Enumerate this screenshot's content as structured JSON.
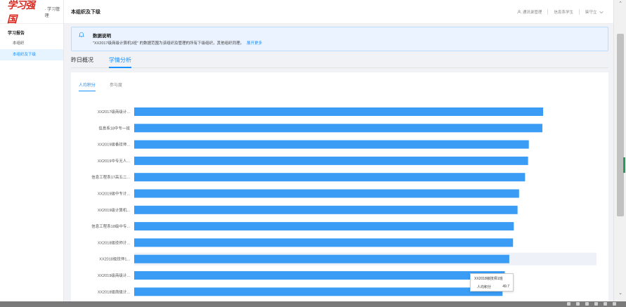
{
  "sidebar": {
    "logo_mark": "学习强国",
    "logo_text": "· 学习管理",
    "group_label": "学习报告",
    "items": [
      {
        "label": "本组织"
      },
      {
        "label": "本组织及下级"
      }
    ]
  },
  "header": {
    "page_title": "本组织及下级",
    "user_action": "通讯录管理",
    "dept": "信息系学生",
    "user_name": "柴守立"
  },
  "notice": {
    "title": "数据说明",
    "body": "\"XX2017级商级计算机3班\" 的数据范围为该组织及管理的所有下级组织，其他组织同理。",
    "link": "展开更多"
  },
  "tabs": [
    {
      "label": "昨日概况"
    },
    {
      "label": "学情分析"
    }
  ],
  "subtabs": [
    {
      "label": "人均积分"
    },
    {
      "label": "参与度"
    }
  ],
  "chart_data": {
    "type": "bar",
    "orientation": "horizontal",
    "categories": [
      "XX2017级商级计...",
      "信息系18中专一班",
      "XX2019级香技师...",
      "XX2019中专无人...",
      "信息工程系17高五二...",
      "XX2019级中专计...",
      "XX2019级计算机...",
      "信息工程系18级中专...",
      "XX2018级技师计...",
      "XX2018级技师1...",
      "XX2019级商级计...",
      "XX2018级商级计..."
    ],
    "series": [
      {
        "values": [
          54.4,
          54.3,
          52.5,
          52.4,
          52.0,
          51.2,
          51.0,
          50.5,
          50.4,
          49.9,
          49.3,
          49.0
        ]
      }
    ],
    "highlight_index": 9,
    "bar_color": "#3a9cf5",
    "highlight_color": "#eef2f8"
  },
  "tooltip": {
    "title": "XX2018级技师1班",
    "metric": "人均积分",
    "value": "49.7"
  },
  "colors": {
    "accent": "#1890ff",
    "logo": "#d9261c"
  }
}
